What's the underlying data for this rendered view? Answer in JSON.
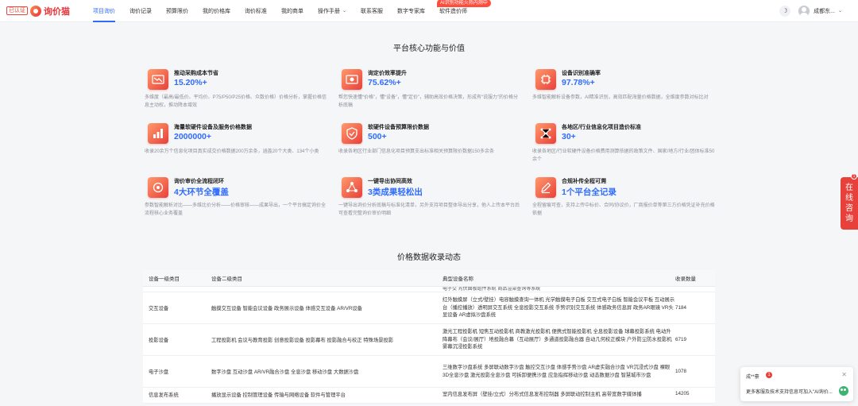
{
  "header": {
    "logo_badge": "已认证",
    "logo_text": "询价猫",
    "ai_badge": "AI识别功能火热内测中",
    "nav": [
      {
        "label": "项目询价",
        "active": true
      },
      {
        "label": "询价记录"
      },
      {
        "label": "预算限价"
      },
      {
        "label": "我的价格库"
      },
      {
        "label": "询价标准"
      },
      {
        "label": "我的商单"
      },
      {
        "label": "操作手册",
        "dropdown": true
      },
      {
        "label": "联系客服"
      },
      {
        "label": "数字专家库"
      },
      {
        "label": "软件造价师"
      }
    ],
    "user_name": "成都东...",
    "theme_icon": "moon-icon"
  },
  "core": {
    "title": "平台核心功能与价值",
    "features": [
      {
        "title": "推动采购成本节省",
        "value": "15.20%+",
        "desc": "多维度（最高/最低价、平均价、P75/P50/P25价格、众数价格）价格分析，掌握价格信息主动权，推动降本增效",
        "icon": "trend-down-icon"
      },
      {
        "title": "询定价效率提升",
        "value": "75.62%+",
        "desc": "帮您快速懂“价格”，懂“设备”，懂“定价”，辅助高效价格决策，形成有“说服力”的价格分析底稿",
        "icon": "document-price-icon"
      },
      {
        "title": "设备识别准确率",
        "value": "97.78%+",
        "desc": "多维智能解析设备参数，AI精准识别，高效匹配海量价格数据，全维度参数对标比对",
        "icon": "chip-icon"
      },
      {
        "title": "海量软硬件设备及服务价格数据",
        "value": "2000000+",
        "desc": "收录20余万个信息化项目真实成交价格数据200万余条，涵盖20个大类、134个小类",
        "icon": "bar-chart-icon"
      },
      {
        "title": "软硬件设备预算限价数据",
        "value": "500+",
        "desc": "收录各地区行业部门信息化项目预算支出标准相关预算限价数据150多余条",
        "icon": "shield-check-icon"
      },
      {
        "title": "各地区/行业信息化项目造价标准",
        "value": "30+",
        "desc": "收录各地区/行业软硬件设备价格费用测算依据的政策文件、国家/地方/行业/团体标准50余个",
        "icon": "network-icon"
      },
      {
        "title": "询价审价全流程闭环",
        "value": "4大环节全覆盖",
        "desc": "参数智能解析对比——多维比价分析——价格审核——成果导出，一个平台搞定询价全流程核心业务覆盖",
        "icon": "loop-icon"
      },
      {
        "title": "一键导出协同高效",
        "value": "3类成果轻松出",
        "desc": "一键导出询价分析底稿与标准化清单，另外支持项目整体导出分享，他人上传本平台后可查看完整询价审价明细",
        "icon": "share-icon"
      },
      {
        "title": "合规补传全程可溯",
        "value": "1个平台全记录",
        "desc": "全程留痕可查，支持上传中标价、合同/协议价，厂商报价单等第三方价格凭证补充价格依据",
        "icon": "pen-icon"
      }
    ]
  },
  "dynamics": {
    "title": "价格数据收录动态",
    "columns": [
      "设备一级类目",
      "设备二级类目",
      "典型设备名称",
      "收录数量"
    ],
    "partial_row_text": "电子交  光伏面板组件系统  商品渲染查询等系统",
    "rows": [
      {
        "cat1": "交互设备",
        "cat2": "触摸交互设备 智能会议设备 政务展示设备 体感交互设备 AR/VR设备",
        "names": "红外触摸屏（立式/壁挂）电容触摸查询一体机 光学触摸电子白板 交互式电子白板 智能会议平板 互动展示台（播控播放）透明屏交互系统 全息投影交互系统 手势识别交互系统 体感政务信息屏 政务AR眼镜 VR头显设备 AR虚拟沙盘系统",
        "count": "7184"
      },
      {
        "cat1": "投影设备",
        "cat2": "工程投影机 会议与教育投影 创意投影设备 投影幕布 投影融合与校正 特殊场景投影",
        "names": "激光工程投影机 短焦互动投影机 商教激光投影机 便携式智能投影机 全息投影设备 球幕投影系统 电动升降幕布（会议/展厅）地投融合幕（互动展厅）多通道投影融合器 自动几何校正模块 户外防尘防水投影机 雾幕沉浸投影系统",
        "count": "6719"
      },
      {
        "cat1": "电子沙盘",
        "cat2": "数字沙盘 互动沙盘 AR/VR融合沙盘 全息沙盘 移动沙盘 大数据沙盘",
        "names": "三维数字沙盘系统 多屏联动数字沙盘 触控交互沙盘 体感手势沙盘 AR虚实融合沙盘 VR沉浸式沙盘 裸眼3D全息沙盘 激光投影全息沙盘 可拆卸便携沙盘 应急指挥移动沙盘 动态数据沙盘 智慧城市沙盘",
        "count": "1078"
      },
      {
        "cat1": "信息发布系统",
        "cat2": "播放显示设备 控制管理设备 传输与网络设备 软件与管理平台",
        "names": "室内信息发布屏（壁挂/立式）分布式信息发布控制器 多屏联动控制主机 高带宽数字媒体播",
        "count": "14205"
      }
    ]
  },
  "side_float": {
    "label_chars": [
      "在",
      "线",
      "咨",
      "询"
    ],
    "badge": "1"
  },
  "chat": {
    "name": "成**豪",
    "badge": "1",
    "message": "更多客服及技术支持信息可加入\"AI询价..."
  }
}
